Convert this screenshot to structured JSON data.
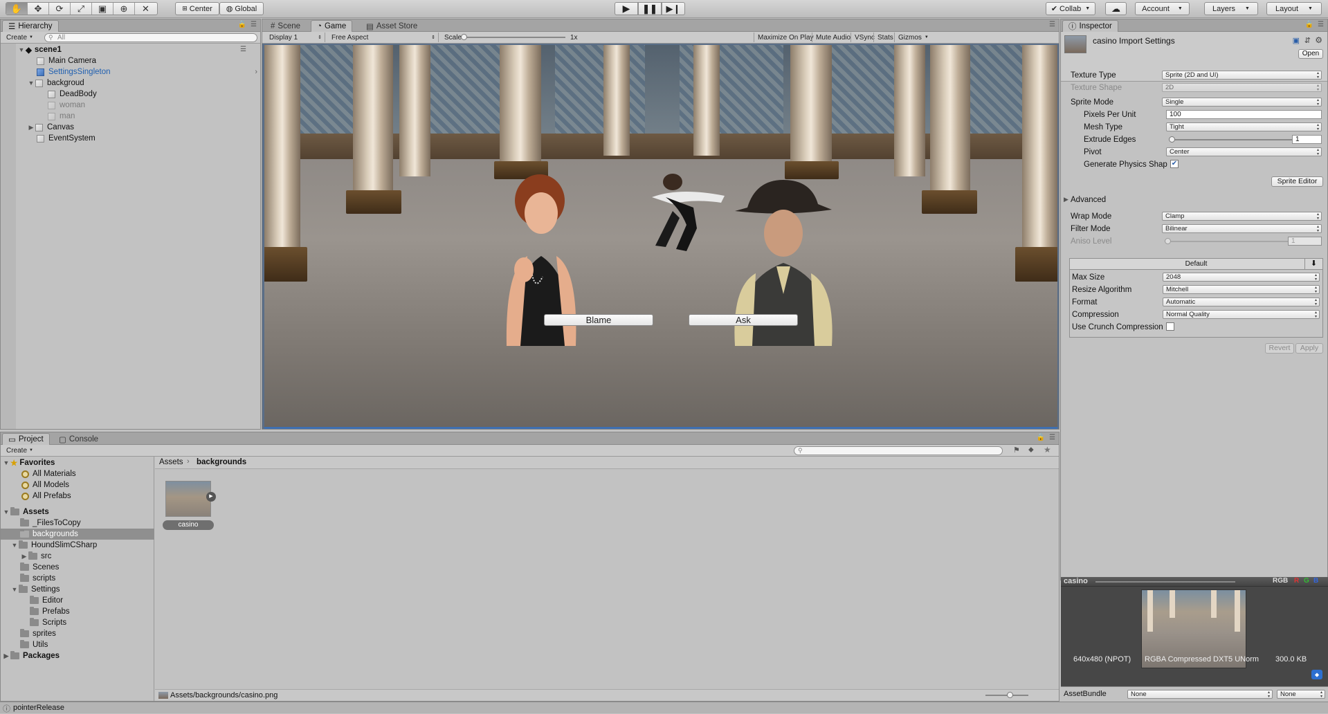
{
  "toolbar": {
    "transform_tools": [
      "✋",
      "✥",
      "⟳",
      "⤢",
      "▣",
      "⊕",
      "✕"
    ],
    "pivot": "Center",
    "space": "Global",
    "collab": "Collab",
    "account": "Account",
    "layers": "Layers",
    "layout": "Layout"
  },
  "hierarchy": {
    "tab": "Hierarchy",
    "create": "Create",
    "search_placeholder": "All",
    "scene": "scene1",
    "items": [
      "Main Camera",
      "SettingsSingleton",
      "backgroud",
      "DeadBody",
      "woman",
      "man",
      "Canvas",
      "EventSystem"
    ]
  },
  "game": {
    "tabs": [
      "Scene",
      "Game",
      "Asset Store"
    ],
    "display": "Display 1",
    "aspect": "Free Aspect",
    "scale_label": "Scale",
    "scale_value": "1x",
    "toggles": [
      "Maximize On Play",
      "Mute Audio",
      "VSync",
      "Stats",
      "Gizmos"
    ],
    "buttons": [
      "Blame",
      "Ask"
    ]
  },
  "inspector": {
    "tab": "Inspector",
    "title": "casino Import Settings",
    "open_button": "Open",
    "texture_type_label": "Texture Type",
    "texture_type": "Sprite (2D and UI)",
    "texture_shape_label": "Texture Shape",
    "texture_shape": "2D",
    "sprite_mode_label": "Sprite Mode",
    "sprite_mode": "Single",
    "ppu_label": "Pixels Per Unit",
    "ppu": "100",
    "mesh_type_label": "Mesh Type",
    "mesh_type": "Tight",
    "extrude_label": "Extrude Edges",
    "extrude": "1",
    "pivot_label": "Pivot",
    "pivot": "Center",
    "physics_label": "Generate Physics Shap",
    "sprite_editor": "Sprite Editor",
    "advanced": "Advanced",
    "wrap_label": "Wrap Mode",
    "wrap": "Clamp",
    "filter_label": "Filter Mode",
    "filter": "Bilinear",
    "aniso_label": "Aniso Level",
    "aniso": "1",
    "platform": "Default",
    "max_size_label": "Max Size",
    "max_size": "2048",
    "resize_label": "Resize Algorithm",
    "resize": "Mitchell",
    "format_label": "Format",
    "format": "Automatic",
    "compression_label": "Compression",
    "compression": "Normal Quality",
    "crunch_label": "Use Crunch Compression",
    "revert": "Revert",
    "apply": "Apply",
    "preview_name": "casino",
    "preview_channels": [
      "RGB",
      "R",
      "G",
      "B"
    ],
    "preview_info_size": "640x480 (NPOT)",
    "preview_info_format": "RGBA Compressed DXT5 UNorm",
    "preview_info_kb": "300.0 KB",
    "assetbundle_label": "AssetBundle",
    "assetbundle_value": "None",
    "assetbundle_variant": "None"
  },
  "project": {
    "tabs": [
      "Project",
      "Console"
    ],
    "create": "Create",
    "favorites": "Favorites",
    "fav_items": [
      "All Materials",
      "All Models",
      "All Prefabs"
    ],
    "assets": "Assets",
    "folders": [
      "_FilesToCopy",
      "backgrounds",
      "HoundSlimCSharp",
      "src",
      "Scenes",
      "scripts",
      "Settings",
      "Editor",
      "Prefabs",
      "Scripts",
      "sprites",
      "Utils"
    ],
    "packages": "Packages",
    "breadcrumb": [
      "Assets",
      "backgrounds"
    ],
    "asset_name": "casino",
    "path": "Assets/backgrounds/casino.png"
  },
  "status": "pointerRelease"
}
